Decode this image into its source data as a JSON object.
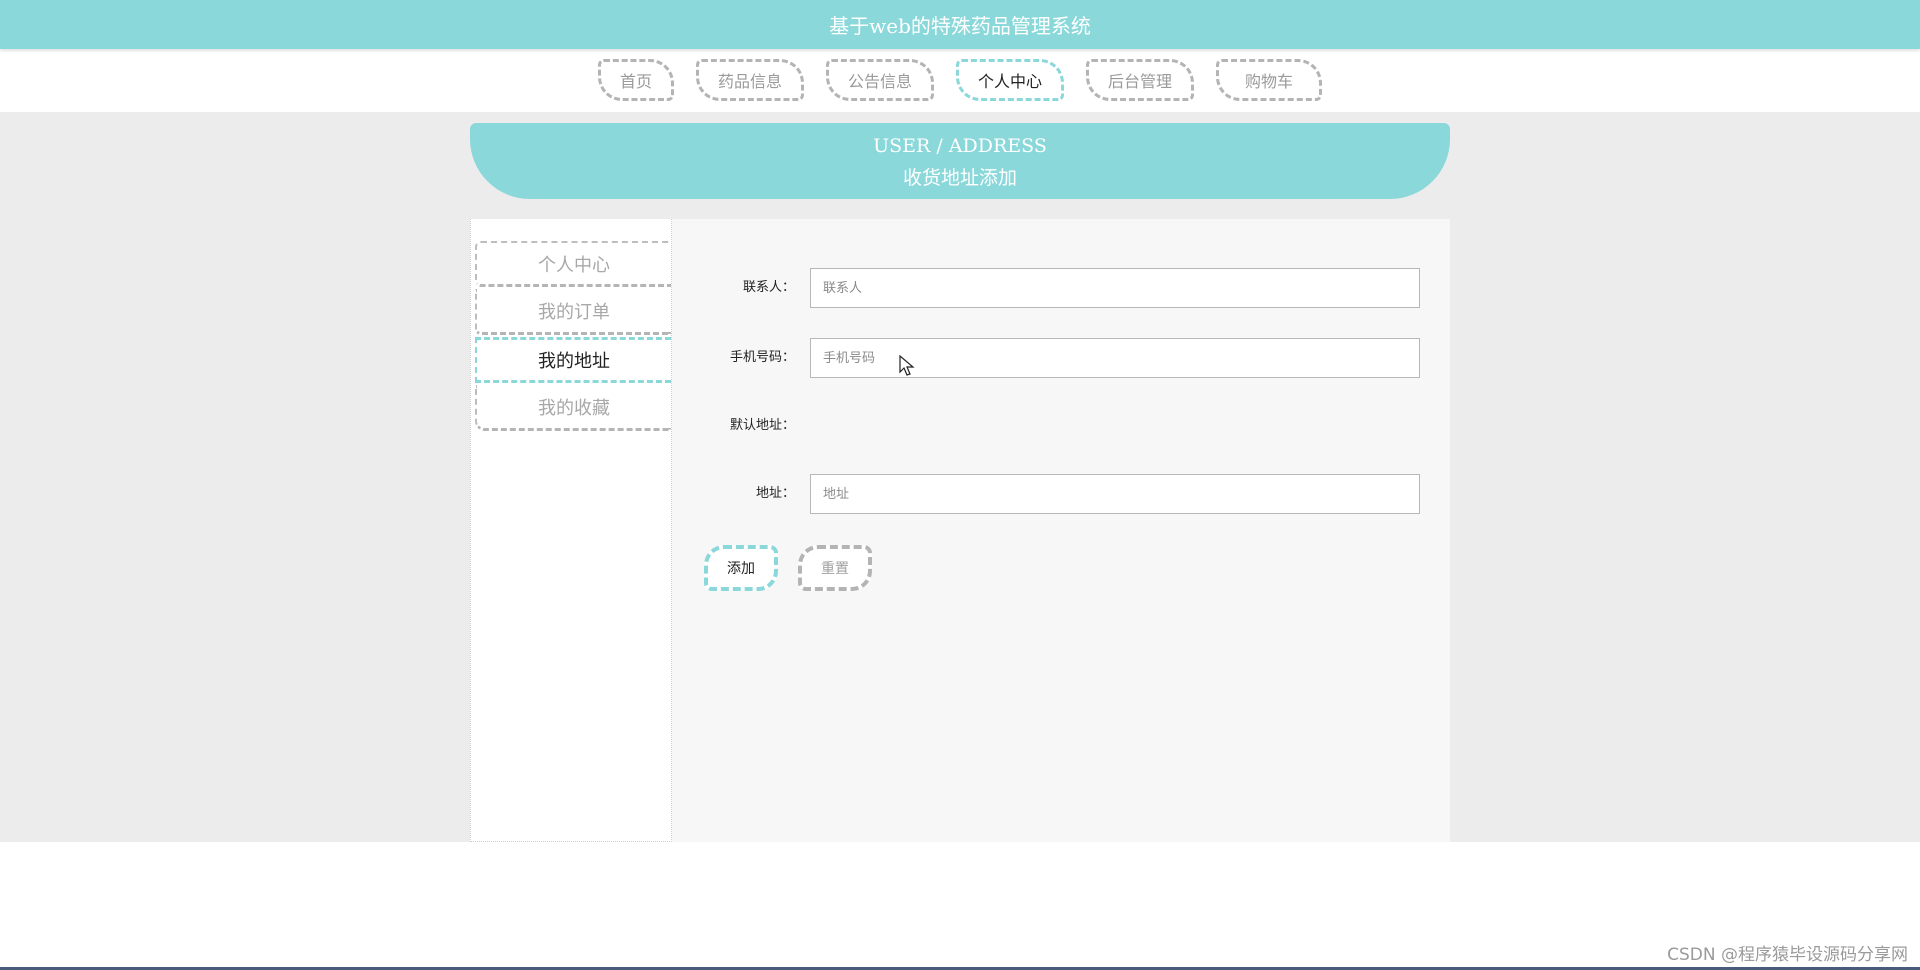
{
  "header": {
    "title": "基于web的特殊药品管理系统"
  },
  "nav": {
    "items": [
      {
        "label": "首页",
        "active": false
      },
      {
        "label": "药品信息",
        "active": false
      },
      {
        "label": "公告信息",
        "active": false
      },
      {
        "label": "个人中心",
        "active": true
      },
      {
        "label": "后台管理",
        "active": false
      },
      {
        "label": "购物车",
        "active": false
      }
    ]
  },
  "banner": {
    "en": "USER / ADDRESS",
    "cn": "收货地址添加"
  },
  "sidebar": {
    "items": [
      {
        "label": "个人中心",
        "active": false
      },
      {
        "label": "我的订单",
        "active": false
      },
      {
        "label": "我的地址",
        "active": true
      },
      {
        "label": "我的收藏",
        "active": false
      }
    ]
  },
  "form": {
    "contact": {
      "label": "联系人：",
      "value": "",
      "placeholder": "联系人"
    },
    "phone": {
      "label": "手机号码：",
      "value": "",
      "placeholder": "手机号码"
    },
    "default_address": {
      "label": "默认地址："
    },
    "address": {
      "label": "地址：",
      "value": "",
      "placeholder": "地址"
    },
    "add_label": "添加",
    "reset_label": "重置"
  },
  "watermark": "CSDN @程序猿毕设源码分享网",
  "colors": {
    "accent": "#8ad8da",
    "inactive_border": "#b4b4b4",
    "content_background": "#ececec",
    "panel_background": "#f7f7f7"
  },
  "icons": {
    "cursor": "mouse-pointer-icon"
  }
}
